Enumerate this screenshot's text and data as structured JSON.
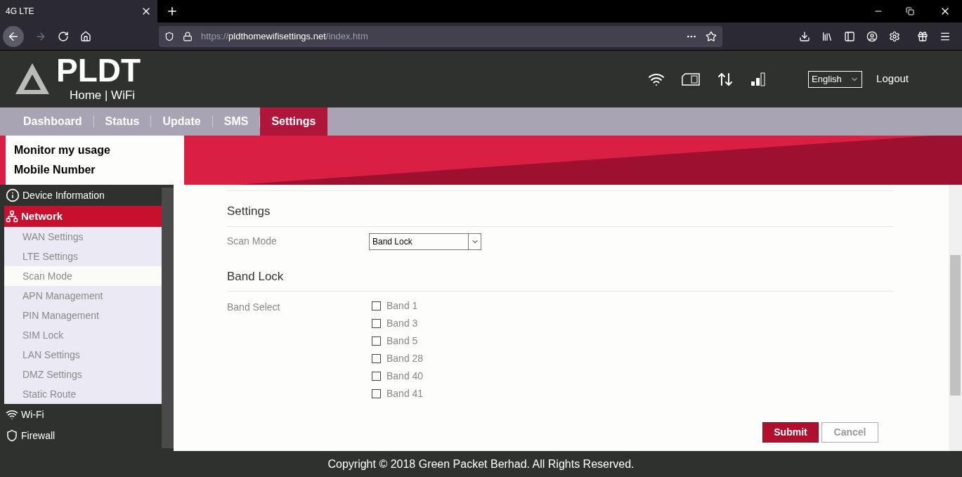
{
  "browser": {
    "tab_title": "4G LTE",
    "url_prefix": "https://",
    "url_host": "pldthomewifisettings.net",
    "url_path": "/index.htm"
  },
  "header": {
    "logo": "PLDT",
    "logo_sub": "Home | WiFi",
    "language": "English",
    "logout": "Logout"
  },
  "nav": [
    {
      "label": "Dashboard",
      "selected": false
    },
    {
      "label": "Status",
      "selected": false
    },
    {
      "label": "Update",
      "selected": false
    },
    {
      "label": "SMS",
      "selected": false
    },
    {
      "label": "Settings",
      "selected": true
    }
  ],
  "quick_links": [
    "Monitor my usage",
    "Mobile Number"
  ],
  "sidebar": [
    {
      "label": "Device Information",
      "kind": "info",
      "expanded": false
    },
    {
      "label": "Network",
      "kind": "network",
      "expanded": true,
      "children": [
        {
          "label": "WAN Settings",
          "selected": false
        },
        {
          "label": "LTE Settings",
          "selected": false
        },
        {
          "label": "Scan Mode",
          "selected": true
        },
        {
          "label": "APN Management",
          "selected": false
        },
        {
          "label": "PIN Management",
          "selected": false
        },
        {
          "label": "SIM Lock",
          "selected": false
        },
        {
          "label": "LAN Settings",
          "selected": false
        },
        {
          "label": "DMZ Settings",
          "selected": false
        },
        {
          "label": "Static Route",
          "selected": false
        }
      ]
    },
    {
      "label": "Wi-Fi",
      "kind": "wifi",
      "expanded": false
    },
    {
      "label": "Firewall",
      "kind": "firewall",
      "expanded": false
    }
  ],
  "settings": {
    "title": "Settings",
    "scan_mode_label": "Scan Mode",
    "scan_mode_value": "Band Lock"
  },
  "band_lock": {
    "title": "Band Lock",
    "label": "Band Select",
    "bands": [
      {
        "label": "Band 1",
        "checked": false
      },
      {
        "label": "Band 3",
        "checked": false
      },
      {
        "label": "Band 5",
        "checked": false
      },
      {
        "label": "Band 28",
        "checked": false
      },
      {
        "label": "Band 40",
        "checked": false
      },
      {
        "label": "Band 41",
        "checked": false
      }
    ]
  },
  "buttons": {
    "submit": "Submit",
    "cancel": "Cancel"
  },
  "footer": "Copyright © 2018 Green Packet Berhad. All Rights Reserved."
}
